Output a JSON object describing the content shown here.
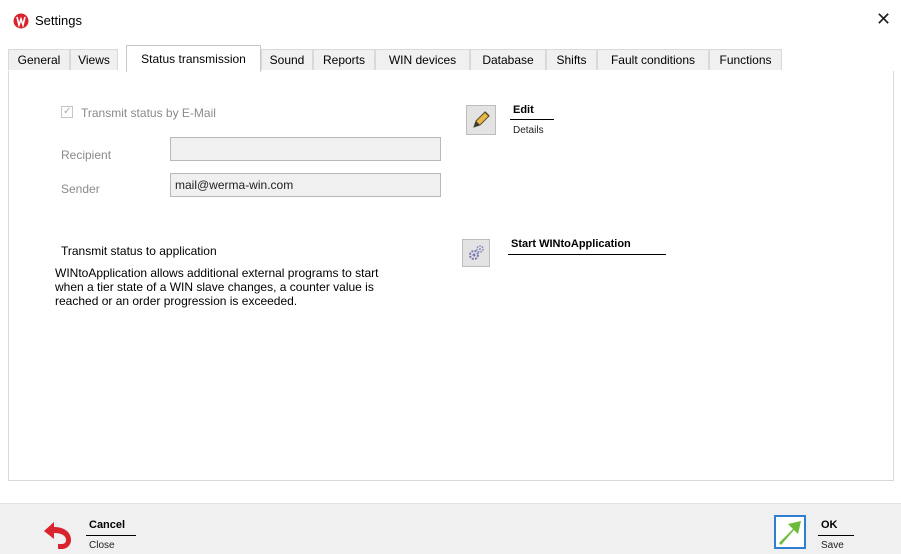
{
  "window": {
    "title": "Settings",
    "app_icon": "werma-logo-icon",
    "close_glyph": "✕"
  },
  "tabs": [
    {
      "label": "General"
    },
    {
      "label": "Views"
    },
    {
      "label": "Status transmission"
    },
    {
      "label": "Sound"
    },
    {
      "label": "Reports"
    },
    {
      "label": "WIN devices"
    },
    {
      "label": "Database"
    },
    {
      "label": "Shifts"
    },
    {
      "label": "Fault conditions"
    },
    {
      "label": "Functions"
    }
  ],
  "email": {
    "checkbox_label": "Transmit status by E-Mail",
    "checkbox_checked": true,
    "recipient_label": "Recipient",
    "recipient_value": "",
    "sender_label": "Sender",
    "sender_value": "mail@werma-win.com",
    "edit_title": "Edit",
    "edit_subtitle": "Details",
    "edit_icon": "pencil-icon"
  },
  "application": {
    "heading": "Transmit status to application",
    "description_line1": "WINtoApplication allows additional external programs to start",
    "description_line2": "when a tier state of a WIN slave changes, a counter value is",
    "description_line3": "reached or an order progression is exceeded.",
    "start_label": "Start WINtoApplication",
    "start_icon": "gears-icon"
  },
  "footer": {
    "cancel_title": "Cancel",
    "cancel_subtitle": "Close",
    "cancel_icon": "undo-arrow-icon",
    "ok_title": "OK",
    "ok_subtitle": "Save",
    "ok_icon": "check-arrow-icon"
  },
  "colors": {
    "undo_arrow": "#d9232d",
    "ok_arrow": "#6dbb3a",
    "ok_border": "#2f7fd0"
  }
}
